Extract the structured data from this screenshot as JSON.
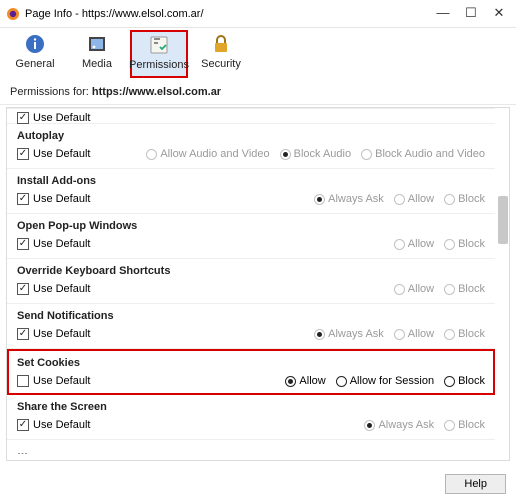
{
  "window": {
    "title": "Page Info - https://www.elsol.com.ar/"
  },
  "toolbar": {
    "general": "General",
    "media": "Media",
    "permissions": "Permissions",
    "security": "Security"
  },
  "perm_bar": {
    "label": "Permissions for:",
    "host": "https://www.elsol.com.ar"
  },
  "cut_section": {
    "use_default": "Use Default"
  },
  "sections": {
    "autoplay": {
      "title": "Autoplay",
      "use_default": "Use Default",
      "opts": {
        "allow_av": "Allow Audio and Video",
        "block_audio": "Block Audio",
        "block_av": "Block Audio and Video"
      }
    },
    "install": {
      "title": "Install Add-ons",
      "use_default": "Use Default",
      "opts": {
        "always_ask": "Always Ask",
        "allow": "Allow",
        "block": "Block"
      }
    },
    "popup": {
      "title": "Open Pop-up Windows",
      "use_default": "Use Default",
      "opts": {
        "allow": "Allow",
        "block": "Block"
      }
    },
    "override": {
      "title": "Override Keyboard Shortcuts",
      "use_default": "Use Default",
      "opts": {
        "allow": "Allow",
        "block": "Block"
      }
    },
    "notifications": {
      "title": "Send Notifications",
      "use_default": "Use Default",
      "opts": {
        "always_ask": "Always Ask",
        "allow": "Allow",
        "block": "Block"
      }
    },
    "cookies": {
      "title": "Set Cookies",
      "use_default": "Use Default",
      "opts": {
        "allow": "Allow",
        "allow_session": "Allow for Session",
        "block": "Block"
      }
    },
    "screen": {
      "title": "Share the Screen",
      "use_default": "Use Default",
      "opts": {
        "always_ask": "Always Ask",
        "block": "Block"
      }
    }
  },
  "footer": {
    "help": "Help"
  }
}
